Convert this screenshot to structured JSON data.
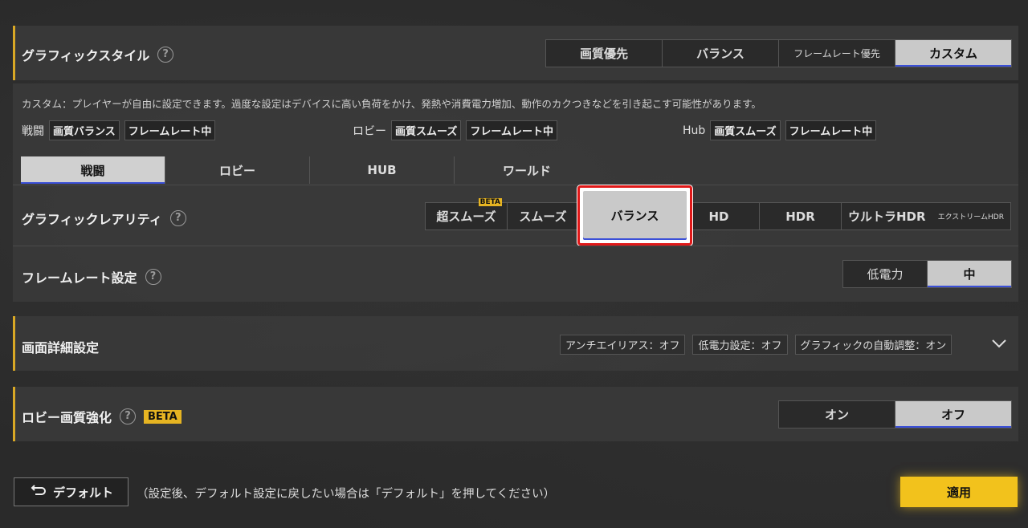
{
  "graphic_style": {
    "title": "グラフィックスタイル",
    "options": [
      "画質優先",
      "バランス",
      "フレームレート優先",
      "カスタム"
    ],
    "selected": "カスタム",
    "description": "カスタム：プレイヤーが自由に設定できます。過度な設定はデバイスに高い負荷をかけ、発熱や消費電力増加、動作のカクつきなどを引き起こす可能性があります。"
  },
  "summary": {
    "battle": {
      "label": "戦闘",
      "quality": "画質バランス",
      "framerate": "フレームレート中"
    },
    "lobby": {
      "label": "ロビー",
      "quality": "画質スムーズ",
      "framerate": "フレームレート中"
    },
    "hub": {
      "label": "Hub",
      "quality": "画質スムーズ",
      "framerate": "フレームレート中"
    }
  },
  "tabs": [
    "戦闘",
    "ロビー",
    "HUB",
    "ワールド"
  ],
  "selected_tab": "戦闘",
  "rarity": {
    "title": "グラフィックレアリティ",
    "options": [
      "超スムーズ",
      "スムーズ",
      "バランス",
      "HD",
      "HDR",
      "ウルトラHDR",
      "エクストリームHDR"
    ],
    "beta_badge": "BETA",
    "selected": "バランス"
  },
  "framerate": {
    "title": "フレームレート設定",
    "options": [
      "低電力",
      "中"
    ],
    "selected": "中"
  },
  "detail": {
    "title": "画面詳細設定",
    "chips": [
      "アンチエイリアス：オフ",
      "低電力設定：オフ",
      "グラフィックの自動調整：オン"
    ]
  },
  "lobby_enhance": {
    "title": "ロビー画質強化",
    "beta": "BETA",
    "options": [
      "オン",
      "オフ"
    ],
    "selected": "オフ"
  },
  "footer": {
    "default_label": "デフォルト",
    "hint": "（設定後、デフォルト設定に戻したい場合は「デフォルト」を押してください）",
    "apply_label": "適用"
  },
  "colors": {
    "accent": "#d9a825",
    "highlight": "#e01818",
    "apply": "#f2c21c"
  }
}
